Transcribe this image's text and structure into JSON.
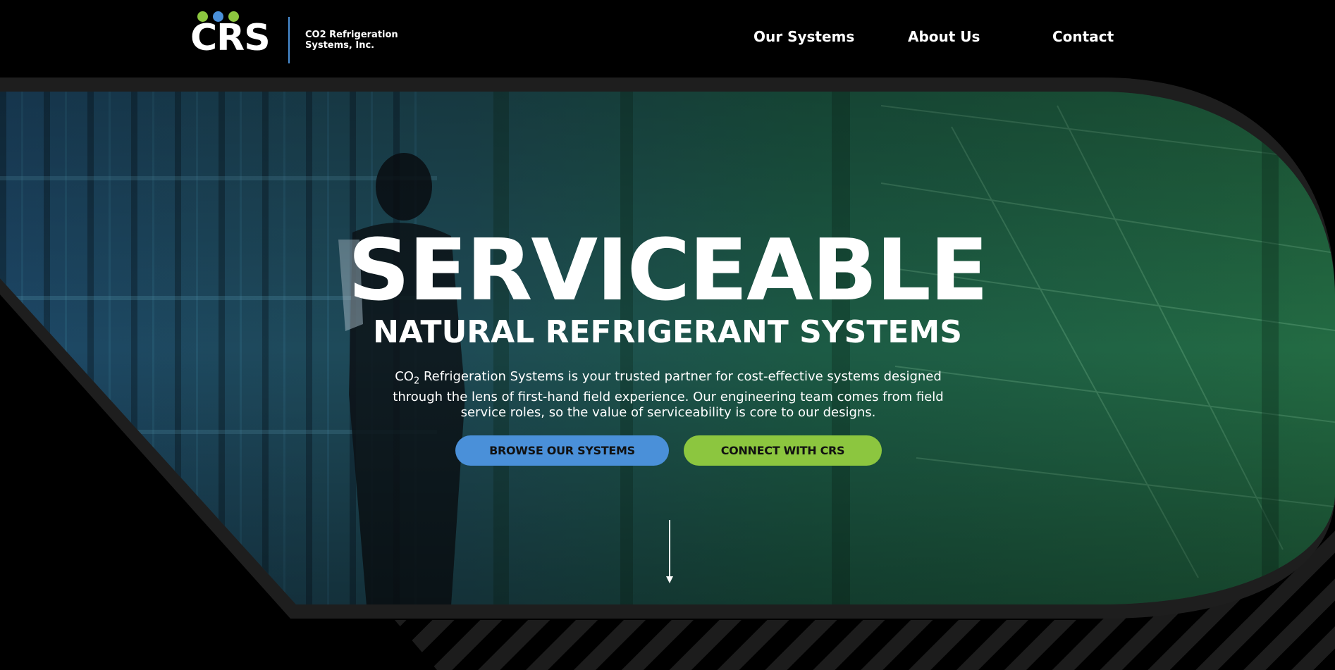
{
  "brand": {
    "logo_text": "CRS",
    "company_line_1": "CO2 Refrigeration",
    "company_line_2": "Systems, Inc.",
    "dot_colors": [
      "#8cc63f",
      "#4a90d9",
      "#8cc63f"
    ]
  },
  "nav": {
    "items": [
      {
        "label": "Our Systems"
      },
      {
        "label": "About Us"
      },
      {
        "label": "Contact"
      }
    ]
  },
  "hero": {
    "headline": "SERVICEABLE",
    "subheadline": "NATURAL REFRIGERANT SYSTEMS",
    "description_prefix": "CO",
    "description_subscript": "2",
    "description_rest": " Refrigeration Systems is your trusted partner for cost-effective systems designed through the lens of first-hand field experience. Our engineering team comes from field service roles, so the value of serviceability is core to our designs.",
    "primary_button": "BROWSE OUR SYSTEMS",
    "secondary_button": "CONNECT WITH CRS"
  },
  "colors": {
    "accent_blue": "#4a90d9",
    "accent_green": "#8cc63f",
    "frame_gray": "#1e1e1e",
    "background": "#000000"
  },
  "icons": {
    "scroll": "arrow-down-icon"
  }
}
